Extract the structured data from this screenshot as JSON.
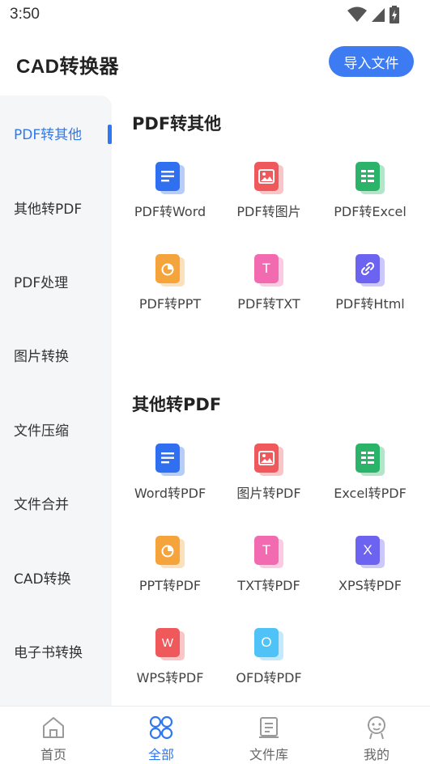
{
  "status": {
    "time": "3:50"
  },
  "header": {
    "title": "CAD转换器",
    "import_label": "导入文件"
  },
  "sidebar": {
    "items": [
      {
        "label": "PDF转其他",
        "active": true
      },
      {
        "label": "其他转PDF"
      },
      {
        "label": "PDF处理"
      },
      {
        "label": "图片转换"
      },
      {
        "label": "文件压缩"
      },
      {
        "label": "文件合并"
      },
      {
        "label": "CAD转换"
      },
      {
        "label": "电子书转换"
      }
    ]
  },
  "sections": [
    {
      "title": "PDF转其他",
      "tools": [
        {
          "label": "PDF转Word",
          "icon": "word-icon",
          "color": "#2f6ff0"
        },
        {
          "label": "PDF转图片",
          "icon": "image-icon",
          "color": "#f0595b"
        },
        {
          "label": "PDF转Excel",
          "icon": "excel-icon",
          "color": "#2bb36a"
        },
        {
          "label": "PDF转PPT",
          "icon": "ppt-icon",
          "color": "#f5a33b"
        },
        {
          "label": "PDF转TXT",
          "icon": "txt-icon",
          "color": "#f26bb0"
        },
        {
          "label": "PDF转Html",
          "icon": "link-icon",
          "color": "#6c63f0"
        }
      ]
    },
    {
      "title": "其他转PDF",
      "tools": [
        {
          "label": "Word转PDF",
          "icon": "word-icon",
          "color": "#2f6ff0"
        },
        {
          "label": "图片转PDF",
          "icon": "image-icon",
          "color": "#f0595b"
        },
        {
          "label": "Excel转PDF",
          "icon": "excel-icon",
          "color": "#2bb36a"
        },
        {
          "label": "PPT转PDF",
          "icon": "ppt-icon",
          "color": "#f5a33b"
        },
        {
          "label": "TXT转PDF",
          "icon": "txt-icon",
          "color": "#f26bb0"
        },
        {
          "label": "XPS转PDF",
          "icon": "xps-icon",
          "color": "#6c63f0"
        },
        {
          "label": "WPS转PDF",
          "icon": "wps-icon",
          "color": "#f0595b"
        },
        {
          "label": "OFD转PDF",
          "icon": "ofd-icon",
          "color": "#4fc3f7"
        }
      ]
    }
  ],
  "icon_letters": {
    "txt": "T",
    "xps": "X",
    "wps": "W",
    "ofd": "O"
  },
  "bottom_nav": [
    {
      "label": "首页",
      "icon": "home-icon"
    },
    {
      "label": "全部",
      "icon": "grid-icon",
      "active": true
    },
    {
      "label": "文件库",
      "icon": "file-library-icon"
    },
    {
      "label": "我的",
      "icon": "profile-icon"
    }
  ]
}
